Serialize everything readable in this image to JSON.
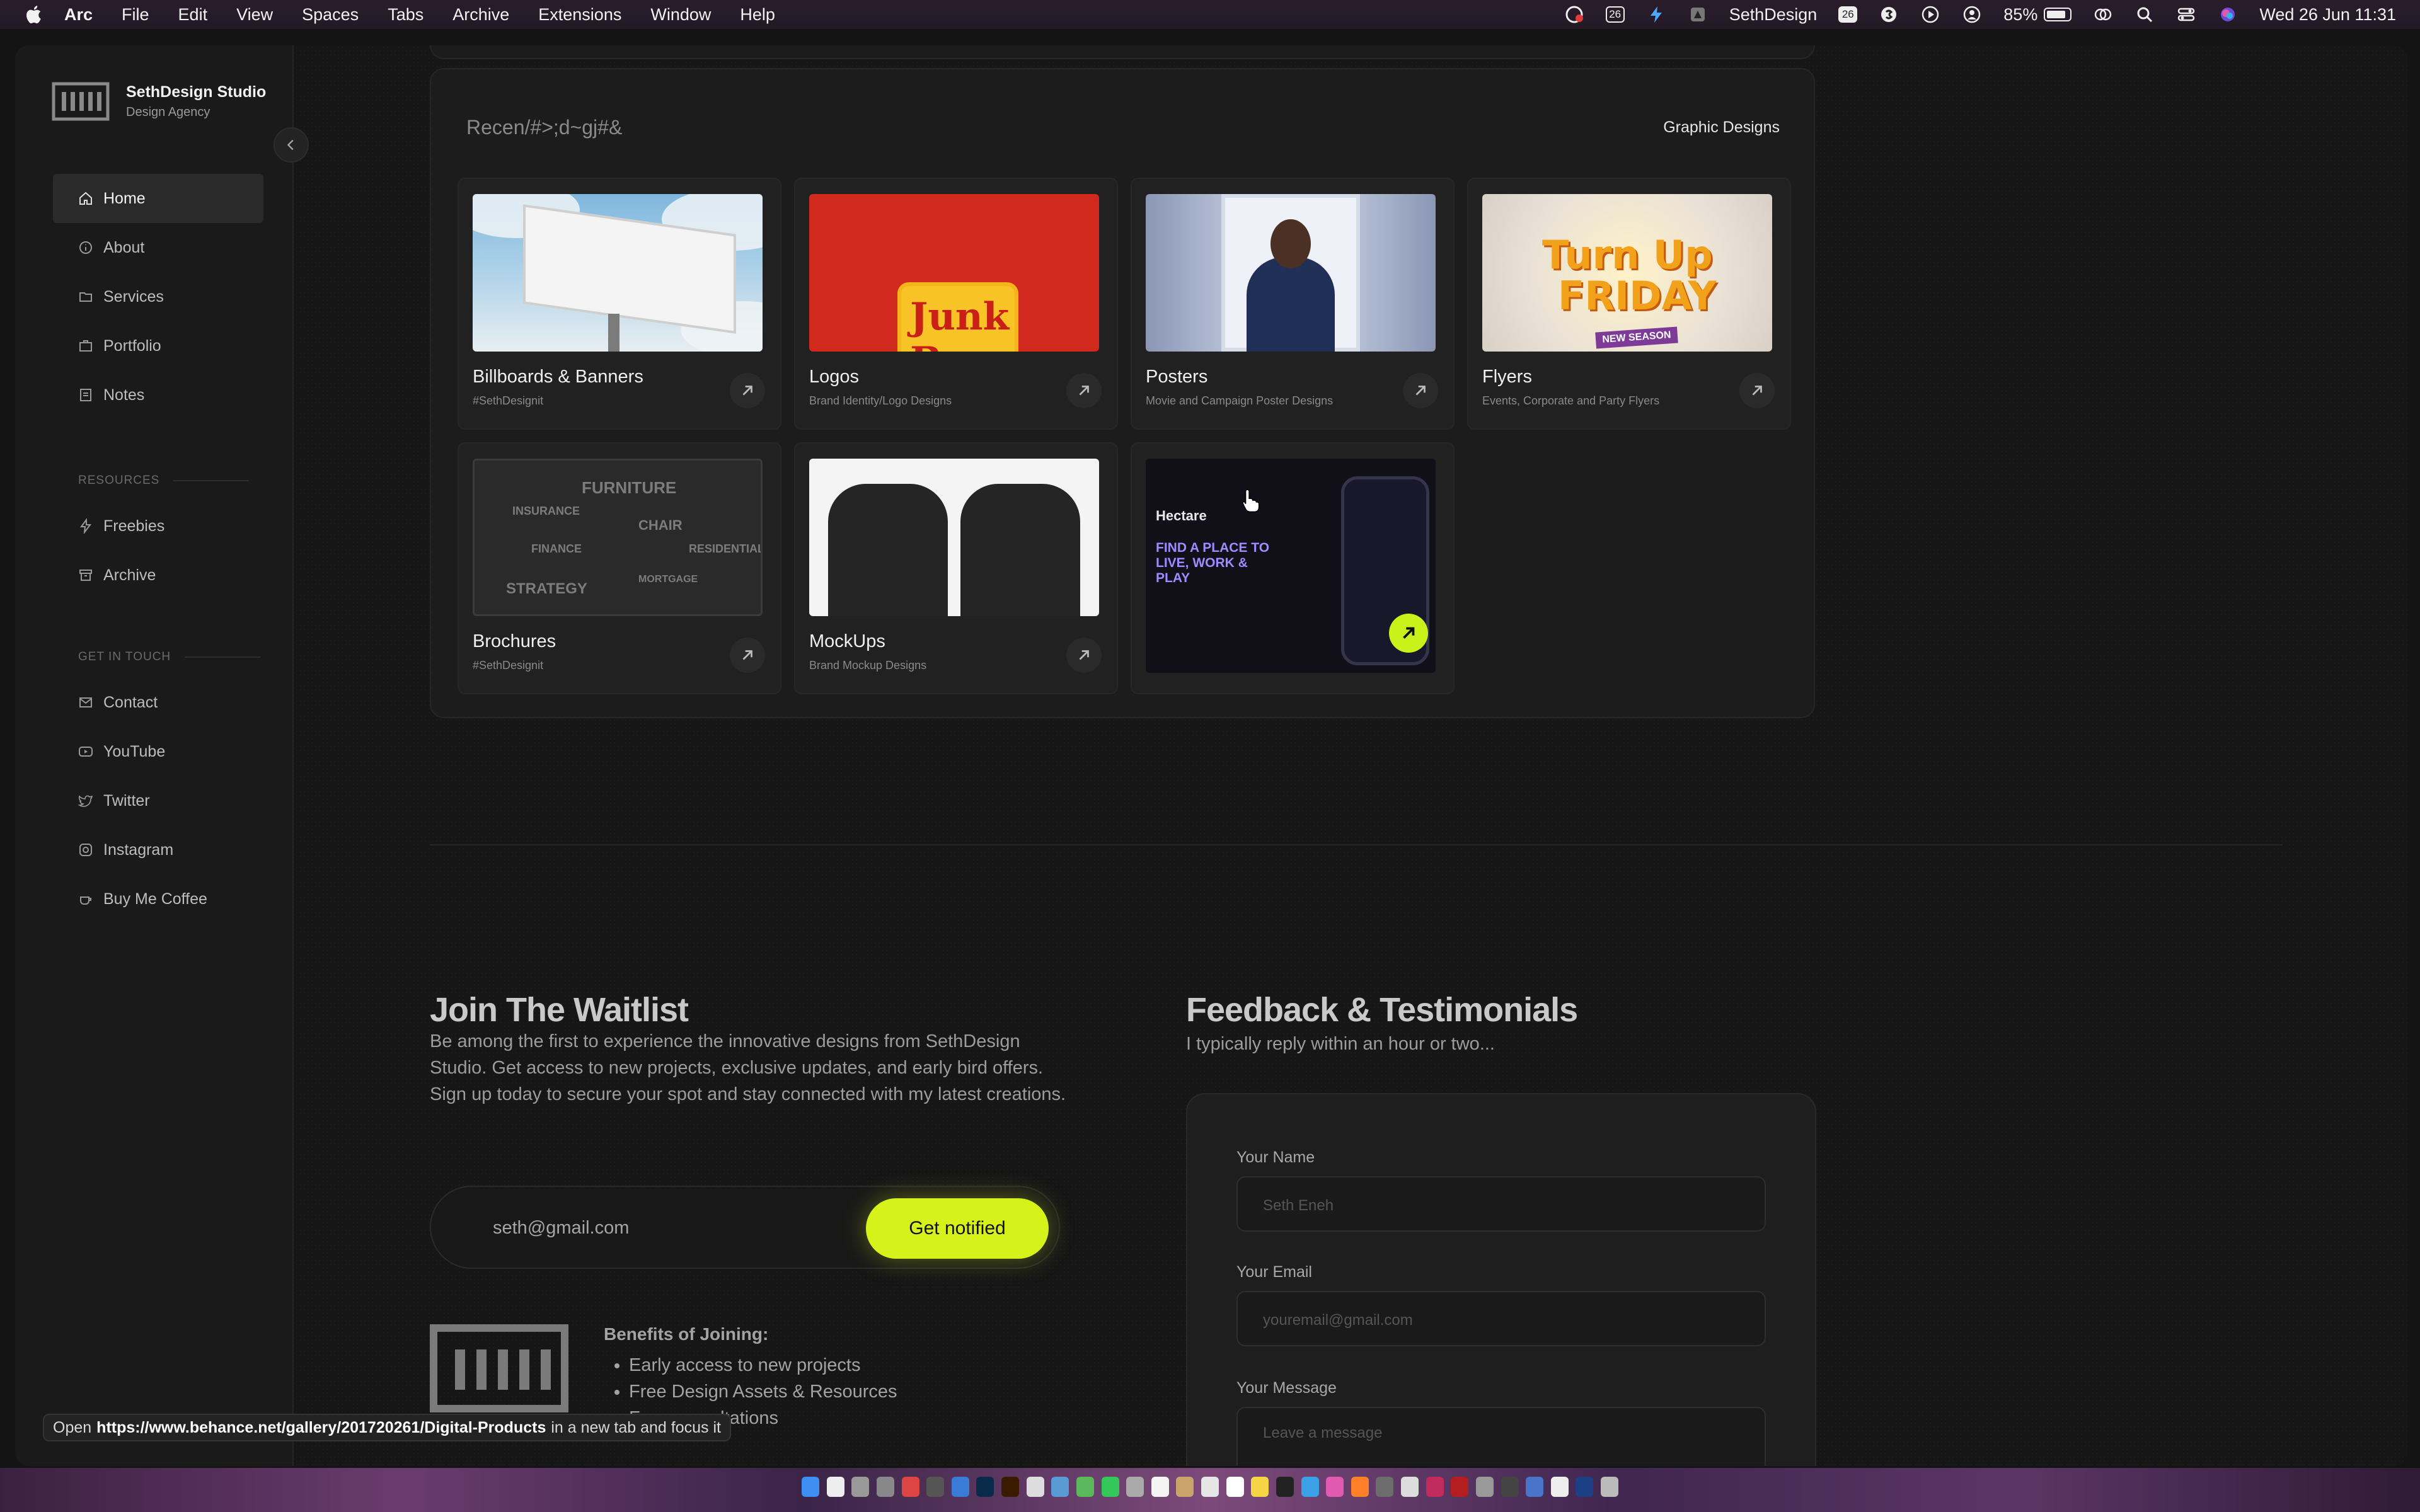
{
  "menubar": {
    "app": "Arc",
    "items": [
      "File",
      "Edit",
      "View",
      "Spaces",
      "Tabs",
      "Archive",
      "Extensions",
      "Window",
      "Help"
    ],
    "calendar_day": "26",
    "profile": "SethDesign",
    "profile_badge": "26",
    "battery": "85%",
    "battery_level": 0.85,
    "clock": "Wed 26 Jun  11:31"
  },
  "sidebar": {
    "brand_name": "SethDesign Studio",
    "brand_sub": "Design Agency",
    "nav": [
      {
        "label": "Home",
        "icon": "home-icon"
      },
      {
        "label": "About",
        "icon": "info-icon"
      },
      {
        "label": "Services",
        "icon": "folder-icon"
      },
      {
        "label": "Portfolio",
        "icon": "briefcase-icon"
      },
      {
        "label": "Notes",
        "icon": "note-icon"
      }
    ],
    "resources_heading": "RESOURCES",
    "resources": [
      {
        "label": "Freebies",
        "icon": "bolt-icon"
      },
      {
        "label": "Archive",
        "icon": "archive-icon"
      }
    ],
    "contact_heading": "GET IN TOUCH",
    "contact": [
      {
        "label": "Contact",
        "icon": "mail-icon"
      },
      {
        "label": "YouTube",
        "icon": "youtube-icon"
      },
      {
        "label": "Twitter",
        "icon": "twitter-icon"
      },
      {
        "label": "Instagram",
        "icon": "instagram-icon"
      },
      {
        "label": "Buy Me Coffee",
        "icon": "coffee-icon"
      }
    ]
  },
  "panel": {
    "title": "Recen/#>;d~gj#&",
    "link": "Graphic Designs",
    "cards": [
      {
        "title": "Billboards & Banners",
        "sub": "#SethDesignit"
      },
      {
        "title": "Logos",
        "sub": "Brand Identity/Logo Designs",
        "thumb_text": "Junk Box"
      },
      {
        "title": "Posters",
        "sub": "Movie and Campaign Poster Designs"
      },
      {
        "title": "Flyers",
        "sub": "Events, Corporate and Party Flyers",
        "thumb_line1": "Turn Up",
        "thumb_line2": "FRIDAY",
        "thumb_badge": "NEW SEASON"
      },
      {
        "title": "Brochures",
        "sub": "#SethDesignit"
      },
      {
        "title": "MockUps",
        "sub": "Brand Mockup Designs"
      }
    ],
    "feature": {
      "brand": "Hectare",
      "headline": "FIND A PLACE TO LIVE, WORK & PLAY"
    }
  },
  "waitlist": {
    "title": "Join The Waitlist",
    "body": "Be among the first to experience the innovative designs from SethDesign Studio. Get access to new projects, exclusive updates, and early bird offers. Sign up today to secure your spot and stay connected with my latest creations.",
    "email_placeholder": "seth@gmail.com",
    "button": "Get notified",
    "benefits_title": "Benefits of Joining:",
    "benefits": [
      "Early access to new projects",
      "Free Design Assets & Resources",
      "Free consultations"
    ]
  },
  "feedback": {
    "title": "Feedback & Testimonials",
    "subtitle": "I typically reply within an hour or two...",
    "name_label": "Your Name",
    "name_placeholder": "Seth Eneh",
    "email_label": "Your Email",
    "email_placeholder": "youremail@gmail.com",
    "message_label": "Your Message",
    "message_placeholder": "Leave a message"
  },
  "status": {
    "prefix": "Open",
    "url": "https://www.behance.net/gallery/201720261/Digital-Products",
    "suffix": "in a new tab and focus it"
  }
}
